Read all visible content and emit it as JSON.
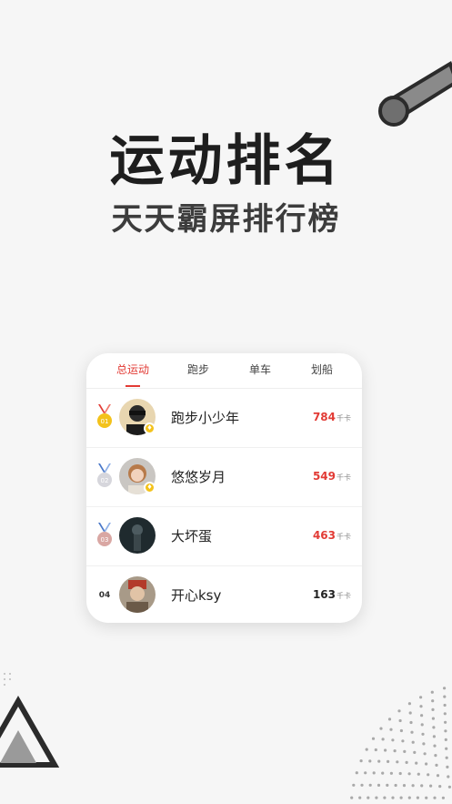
{
  "header": {
    "title": "运动排名",
    "subtitle": "天天霸屏排行榜"
  },
  "tabs": [
    {
      "label": "总运动",
      "active": true
    },
    {
      "label": "跑步"
    },
    {
      "label": "单车"
    },
    {
      "label": "划船"
    }
  ],
  "ranking": [
    {
      "rank": "01",
      "name": "跑步小少年",
      "score": "784",
      "unit": "千卡",
      "medal": "gold"
    },
    {
      "rank": "02",
      "name": "悠悠岁月",
      "score": "549",
      "unit": "千卡",
      "medal": "silver"
    },
    {
      "rank": "03",
      "name": "大坏蛋",
      "score": "463",
      "unit": "千卡",
      "medal": "bronze"
    },
    {
      "rank": "04",
      "name": "开心ksy",
      "score": "163",
      "unit": "千卡",
      "medal": "none"
    }
  ],
  "colors": {
    "accent": "#e23b35",
    "background": "#f6f6f6",
    "card": "#ffffff"
  }
}
